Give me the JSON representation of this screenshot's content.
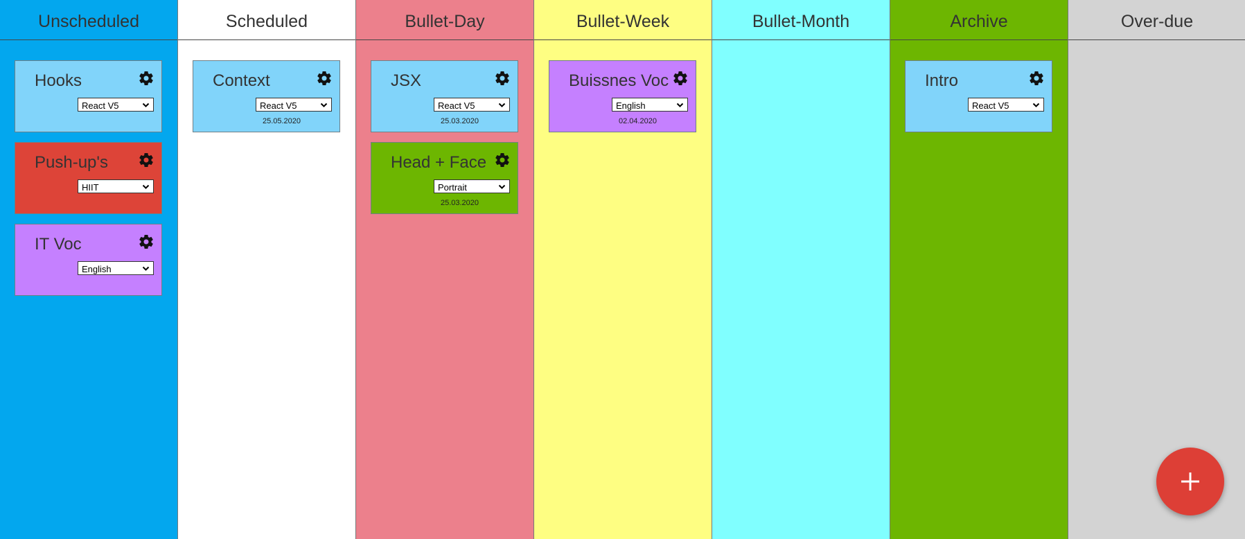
{
  "colors": {
    "col_unscheduled": "#03a7ee",
    "col_scheduled": "#ffffff",
    "col_bullet_day": "#ec808c",
    "col_bullet_week": "#fefe82",
    "col_bullet_month": "#80ffff",
    "col_archive": "#6db601",
    "col_overdue": "#d3d3d3",
    "card_blue": "#81d4fa",
    "card_red": "#dd4438",
    "card_purple": "#c580ff",
    "card_green": "#6db601",
    "fab": "#dd3f36"
  },
  "columns": [
    {
      "title": "Unscheduled",
      "cards": [
        {
          "title": "Hooks",
          "category": "React V5",
          "date": "",
          "color": "card_blue"
        },
        {
          "title": "Push-up's",
          "category": "HIIT",
          "date": "",
          "color": "card_red"
        },
        {
          "title": "IT Voc",
          "category": "English",
          "date": "",
          "color": "card_purple"
        }
      ]
    },
    {
      "title": "Scheduled",
      "cards": [
        {
          "title": "Context",
          "category": "React V5",
          "date": "25.05.2020",
          "color": "card_blue"
        }
      ]
    },
    {
      "title": "Bullet-Day",
      "cards": [
        {
          "title": "JSX",
          "category": "React V5",
          "date": "25.03.2020",
          "color": "card_blue"
        },
        {
          "title": "Head + Face",
          "category": "Portrait",
          "date": "25.03.2020",
          "color": "card_green"
        }
      ]
    },
    {
      "title": "Bullet-Week",
      "cards": [
        {
          "title": "Buissnes Voc",
          "category": "English",
          "date": "02.04.2020",
          "color": "card_purple"
        }
      ]
    },
    {
      "title": "Bullet-Month",
      "cards": []
    },
    {
      "title": "Archive",
      "cards": [
        {
          "title": "Intro",
          "category": "React V5",
          "date": "",
          "color": "card_blue"
        }
      ]
    },
    {
      "title": "Over-due",
      "cards": []
    }
  ],
  "icons": {
    "card_settings": "gear-icon",
    "card_select": "chevron-down-icon",
    "add_button": "plus-icon"
  }
}
